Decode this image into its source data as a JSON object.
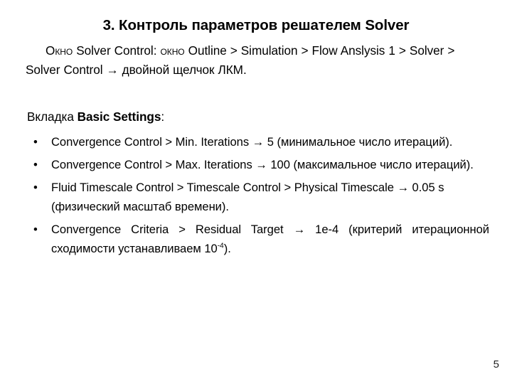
{
  "slide": {
    "title": "3. Контроль параметров решателем Solver",
    "intro": {
      "lead_caps": "О",
      "lead_rest": "кно",
      "after_lead": " Solver Control: ",
      "second_caps": "о",
      "second_rest": "кно",
      "tail": " Outline > Simulation > Flow Anslysis 1 > Solver > Solver Control → двойной щелчок ЛКМ.",
      "full_text": "Окно Solver Control: окно Outline > Simulation > Flow Anslysis 1 > Solver > Solver Control → двойной щелчок ЛКМ."
    },
    "section_label": {
      "prefix": "Вкладка ",
      "emphasis": "Basic Settings",
      "suffix": ":"
    },
    "bullets": [
      {
        "marker": "•",
        "text": "Convergence Control > Min. Iterations → 5 (минимальное число итераций).",
        "path": "Convergence Control > Min. Iterations",
        "value": "5",
        "note": "минимальное число итераций"
      },
      {
        "marker": "•",
        "text": "Convergence Control > Max. Iterations → 100 (максимальное число итераций).",
        "path": "Convergence Control > Max. Iterations",
        "value": "100",
        "note": "максимальное число итераций"
      },
      {
        "marker": "•",
        "text": "Fluid Timescale Control > Timescale Control > Physical Timescale → 0.05 s (физический масштаб времени).",
        "path": "Fluid Timescale Control > Timescale Control > Physical Timescale",
        "value": "0.05 s",
        "note": "физический масштаб времени"
      },
      {
        "marker": "•",
        "lead": "Convergence Criteria > Residual Target → 1e-4 (критерий итерационной сходимости устанавливаем 10",
        "superscript": "-4",
        "trail": ").",
        "text": "Convergence Criteria > Residual Target → 1e-4 (критерий итерационной сходимости устанавливаем 10-4).",
        "path": "Convergence Criteria > Residual Target",
        "value": "1e-4",
        "note": "критерий итерационной сходимости устанавливаем 10⁻⁴"
      }
    ],
    "page_number": "5"
  },
  "colors": {
    "background": "#ffffff",
    "text": "#000000",
    "page_number": "#222222"
  }
}
